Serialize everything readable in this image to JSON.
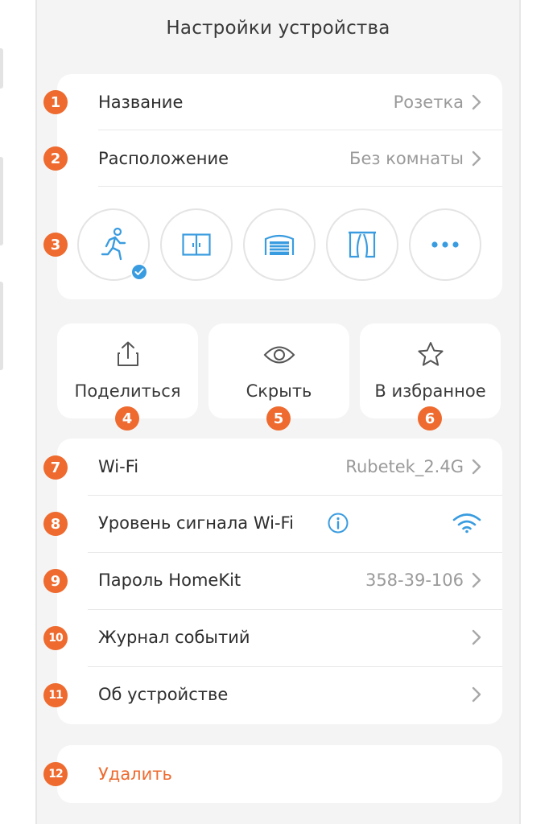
{
  "header": {
    "title": "Настройки устройства"
  },
  "general": {
    "name": {
      "badge": "1",
      "label": "Название",
      "value": "Розетка"
    },
    "location": {
      "badge": "2",
      "label": "Расположение",
      "value": "Без комнаты"
    },
    "icons_badge": "3",
    "icons": [
      "running-man-icon",
      "window-icon",
      "garage-door-icon",
      "curtains-icon",
      "more-dots-icon"
    ],
    "selected_icon": "running-man-icon"
  },
  "actions": [
    {
      "label": "Поделиться",
      "badge": "4",
      "icon": "share-icon"
    },
    {
      "label": "Скрыть",
      "badge": "5",
      "icon": "eye-icon"
    },
    {
      "label": "В избранное",
      "badge": "6",
      "icon": "star-icon"
    }
  ],
  "network": {
    "wifi": {
      "badge": "7",
      "label": "Wi-Fi",
      "value": "Rubetek_2.4G"
    },
    "signal": {
      "badge": "8",
      "label": "Уровень сигнала Wi-Fi",
      "icon": "wifi-signal-icon"
    },
    "homekit": {
      "badge": "9",
      "label": "Пароль HomeKit",
      "value": "358-39-106"
    },
    "log": {
      "badge": "10",
      "label": "Журнал событий"
    },
    "about": {
      "badge": "11",
      "label": "Об устройстве"
    }
  },
  "danger": {
    "badge": "12",
    "label": "Удалить"
  },
  "colors": {
    "accent": "#ee6a2e",
    "icon_blue": "#3a9ce0",
    "background": "#f4f4f4",
    "card": "#ffffff",
    "muted_text": "#9a9a9a"
  }
}
